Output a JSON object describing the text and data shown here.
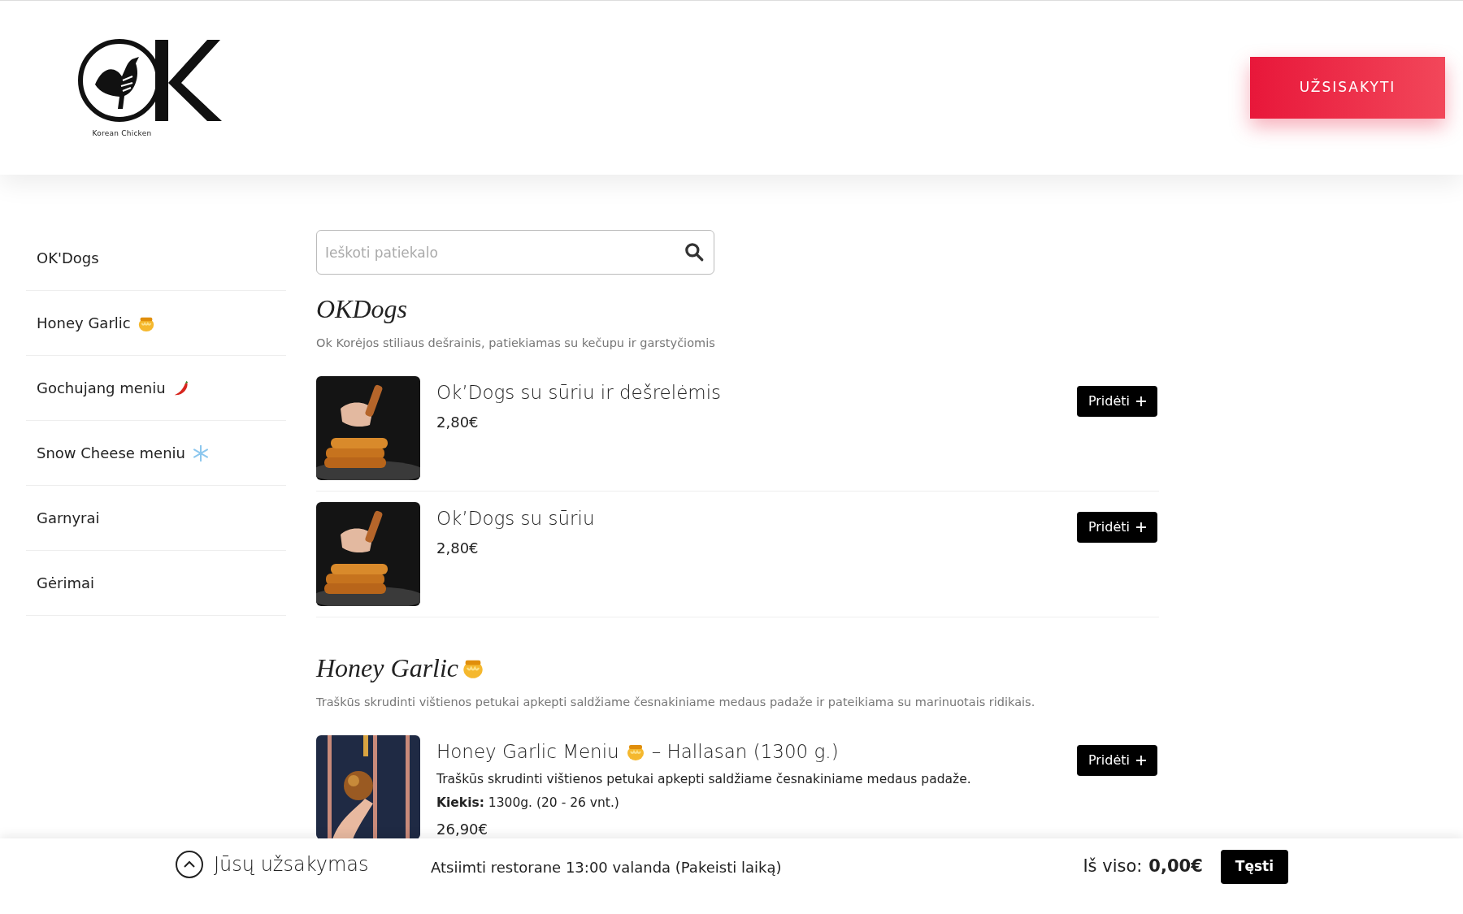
{
  "header": {
    "logo_caption": "Korean Chicken",
    "order_button": "UŽSISAKYTI"
  },
  "sidebar": {
    "items": [
      {
        "label": "OK'Dogs",
        "kind": "plain",
        "selected": false
      },
      {
        "label": "Honey Garlic",
        "kind": "honey",
        "selected": false
      },
      {
        "label": "Gochujang meniu",
        "kind": "chili",
        "selected": false
      },
      {
        "label": "Snow Cheese meniu",
        "kind": "snow",
        "selected": false
      },
      {
        "label": "Garnyrai",
        "kind": "plain",
        "selected": false
      },
      {
        "label": "Gėrimai",
        "kind": "plain",
        "selected": false
      }
    ]
  },
  "search": {
    "placeholder": "Ieškoti patiekalo"
  },
  "sections": [
    {
      "title": "OKDogs",
      "kind": "plain",
      "description": "Ok Korėjos stiliaus dešrainis, patiekiamas su kečupu ir garstyčiomis",
      "items": [
        {
          "title": "Ok’Dogs su sūriu ir dešrelėmis",
          "kind": "plain",
          "price": "2,80€",
          "button": "Pridėti"
        },
        {
          "title": "Ok’Dogs su sūriu",
          "kind": "plain",
          "price": "2,80€",
          "button": "Pridėti"
        }
      ]
    },
    {
      "title": "Honey Garlic",
      "kind": "honey",
      "description": "Traškūs skrudinti vištienos petukai apkepti saldžiame česnakiniame medaus padaže ir pateikiama su marinuotais ridikais.",
      "items": [
        {
          "title": "Honey Garlic Meniu",
          "kind": "honey",
          "title_after": "– Hallasan (1300 g.)",
          "lines": [
            "Traškūs skrudinti vištienos petukai apkepti saldžiame česnakiniame medaus padaže.",
            "**Kiekis:** 1300g. (20 - 26 vnt.)"
          ],
          "price": "26,90€",
          "button": "Pridėti"
        }
      ]
    }
  ],
  "footer": {
    "order_label": "Jūsų užsakymas",
    "pickup": "Atsiimti restorane 13:00 valanda (Pakeisti laiką)",
    "total_label": "Iš viso:",
    "total": "0,00€",
    "continue_button": "Tęsti"
  }
}
